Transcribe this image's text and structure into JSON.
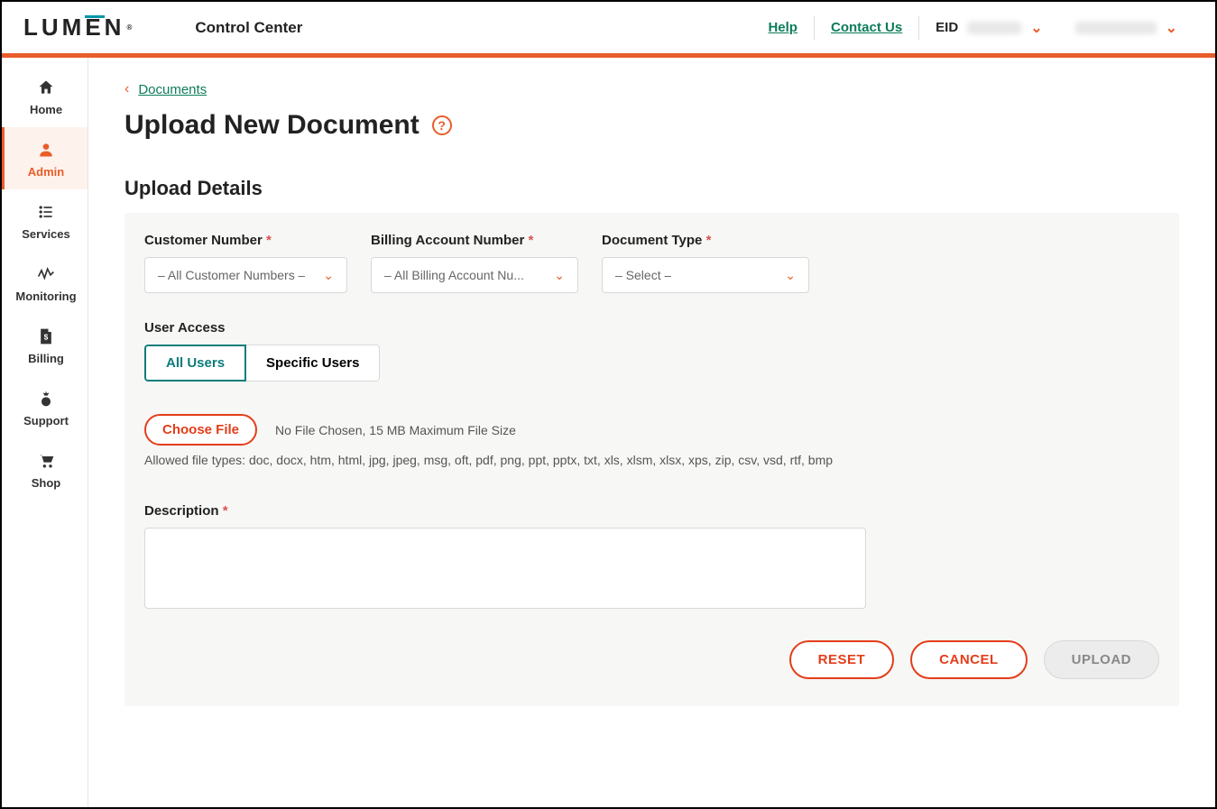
{
  "header": {
    "logo_text": "LUMEN",
    "product": "Control Center",
    "help": "Help",
    "contact": "Contact Us",
    "eid_label": "EID"
  },
  "sidebar": {
    "items": [
      {
        "id": "home",
        "label": "Home"
      },
      {
        "id": "admin",
        "label": "Admin"
      },
      {
        "id": "services",
        "label": "Services"
      },
      {
        "id": "monitoring",
        "label": "Monitoring"
      },
      {
        "id": "billing",
        "label": "Billing"
      },
      {
        "id": "support",
        "label": "Support"
      },
      {
        "id": "shop",
        "label": "Shop"
      }
    ]
  },
  "breadcrumb": {
    "back": "Documents"
  },
  "page": {
    "title": "Upload New Document",
    "section_title": "Upload Details"
  },
  "fields": {
    "customer_number": {
      "label": "Customer Number",
      "value": "– All Customer Numbers –"
    },
    "billing_account": {
      "label": "Billing Account Number",
      "value": "– All Billing Account Nu..."
    },
    "document_type": {
      "label": "Document Type",
      "value": "– Select –"
    },
    "user_access": {
      "label": "User Access",
      "all": "All Users",
      "specific": "Specific Users"
    },
    "choose_file": "Choose File",
    "file_hint": "No File Chosen, 15 MB Maximum File Size",
    "allowed_types": "Allowed file types: doc, docx, htm, html, jpg, jpeg, msg, oft, pdf, png, ppt, pptx, txt, xls, xlsm, xlsx, xps, zip, csv, vsd, rtf, bmp",
    "description_label": "Description"
  },
  "actions": {
    "reset": "RESET",
    "cancel": "CANCEL",
    "upload": "UPLOAD"
  }
}
